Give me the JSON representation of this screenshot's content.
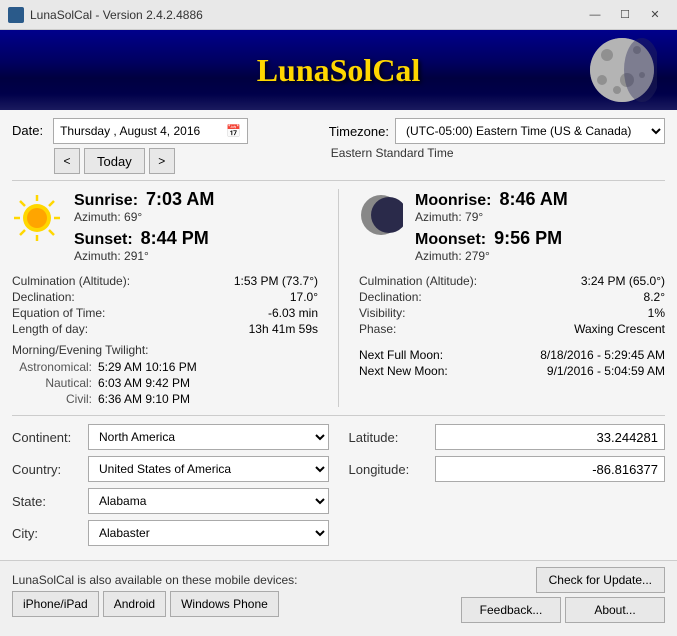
{
  "titleBar": {
    "title": "LunaSolCal - Version 2.4.2.4886",
    "minimizeBtn": "—",
    "maximizeBtn": "☐",
    "closeBtn": "✕"
  },
  "header": {
    "appTitle": "LunaSolCal"
  },
  "dateSection": {
    "label": "Date:",
    "day": "Thursday",
    "month": "August",
    "dayNum": "4",
    "year": "2016",
    "dateDisplay": "Thursday ,  August    4,  2016",
    "prevBtn": "<",
    "todayBtn": "Today",
    "nextBtn": ">"
  },
  "timezoneSection": {
    "label": "Timezone:",
    "selected": "(UTC-05:00) Eastern Time (US & Canada)",
    "description": "Eastern Standard Time"
  },
  "sunSection": {
    "sunriseLabel": "Sunrise:",
    "sunriseTime": "7:03 AM",
    "sunriseAzimuth": "Azimuth:",
    "sunriseAzimuthVal": "69°",
    "sunsetLabel": "Sunset:",
    "sunsetTime": "8:44 PM",
    "sunsetAzimuth": "Azimuth:",
    "sunsetAzimuthVal": "291°",
    "culminationLabel": "Culmination (Altitude):",
    "culminationVal": "1:53 PM (73.7°)",
    "declinationLabel": "Declination:",
    "declinationVal": "17.0°",
    "equationLabel": "Equation of Time:",
    "equationVal": "-6.03 min",
    "lengthLabel": "Length of day:",
    "lengthVal": "13h 41m 59s",
    "twilightTitle": "Morning/Evening Twilight:",
    "astronomical": "Astronomical:",
    "astronomicalTimes": "5:29 AM    10:16 PM",
    "nautical": "Nautical:",
    "nauticalTimes": "6:03 AM      9:42 PM",
    "civil": "Civil:",
    "civilTimes": "6:36 AM      9:10 PM"
  },
  "moonSection": {
    "moonriseLabel": "Moonrise:",
    "moonriseTime": "8:46 AM",
    "moonriseAzimuth": "Azimuth:",
    "moonriseAzimuthVal": "79°",
    "moonsetLabel": "Moonset:",
    "moonsetTime": "9:56 PM",
    "moonsetAzimuth": "Azimuth:",
    "moonsetAzimuthVal": "279°",
    "culminationLabel": "Culmination (Altitude):",
    "culminationVal": "3:24 PM (65.0°)",
    "declinationLabel": "Declination:",
    "declinationVal": "8.2°",
    "visibilityLabel": "Visibility:",
    "visibilityVal": "1%",
    "phaseLabel": "Phase:",
    "phaseVal": "Waxing Crescent",
    "nextFullLabel": "Next Full Moon:",
    "nextFullVal": "8/18/2016 - 5:29:45 AM",
    "nextNewLabel": "Next New Moon:",
    "nextNewVal": "9/1/2016 - 5:04:59 AM"
  },
  "locationSection": {
    "continentLabel": "Continent:",
    "continentVal": "North America",
    "countryLabel": "Country:",
    "countryVal": "United States of America",
    "stateLabel": "State:",
    "stateVal": "Alabama",
    "cityLabel": "City:",
    "cityVal": "Alabaster",
    "latitudeLabel": "Latitude:",
    "latitudeVal": "33.244281",
    "longitudeLabel": "Longitude:",
    "longitudeVal": "-86.816377"
  },
  "footer": {
    "mobileLabel": "LunaSolCal is also available on these mobile devices:",
    "iphone": "iPhone/iPad",
    "android": "Android",
    "windowsPhone": "Windows Phone",
    "checkUpdate": "Check for Update...",
    "feedback": "Feedback...",
    "about": "About..."
  }
}
